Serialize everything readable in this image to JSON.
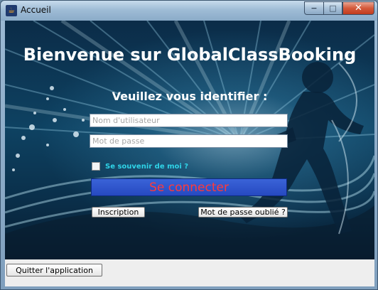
{
  "window": {
    "title": "Accueil",
    "controls": {
      "minimize": "−",
      "maximize": "□",
      "close": "✕"
    }
  },
  "login": {
    "heading": "Bienvenue sur GlobalClassBooking",
    "subheading": "Veuillez vous identifier :",
    "username_placeholder": "Nom d'utilisateur",
    "password_placeholder": "Mot de passe",
    "remember_label": "Se souvenir de moi ?",
    "connect_label": "Se connecter",
    "signup_label": "Inscription",
    "forgot_label": "Mot de passe oublié ?"
  },
  "footer": {
    "quit_label": "Quitter l'application"
  },
  "colors": {
    "connect_bg": "#2649c0",
    "connect_text": "#ff3a3a",
    "remember_text": "#2fd4e8",
    "background_dark": "#0b2c48"
  }
}
